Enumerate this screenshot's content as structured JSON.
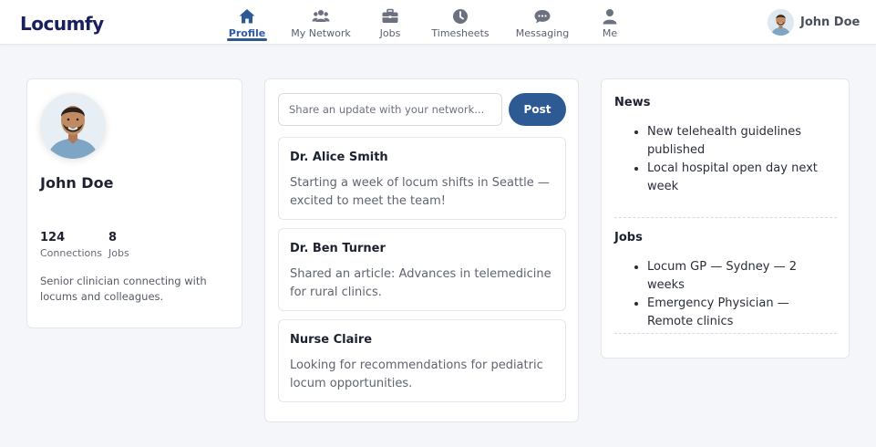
{
  "app": {
    "name": "Locumfy"
  },
  "nav": {
    "items": [
      {
        "label": "Profile",
        "icon": "home-icon",
        "active": true
      },
      {
        "label": "My Network",
        "icon": "users-icon",
        "active": false
      },
      {
        "label": "Jobs",
        "icon": "briefcase-icon",
        "active": false
      },
      {
        "label": "Timesheets",
        "icon": "clock-icon",
        "active": false
      },
      {
        "label": "Messaging",
        "icon": "chat-icon",
        "active": false
      },
      {
        "label": "Me",
        "icon": "user-icon",
        "active": false
      }
    ]
  },
  "user": {
    "name": "John Doe"
  },
  "profile": {
    "name": "John Doe",
    "connections": {
      "value": "124",
      "label": "Connections"
    },
    "jobs": {
      "value": "8",
      "label": "Jobs"
    },
    "bio": "Senior clinician connecting with locums and colleagues."
  },
  "feed": {
    "share_placeholder": "Share an update with your network...",
    "post_label": "Post",
    "posts": [
      {
        "author": "Dr. Alice Smith",
        "text": "Starting a week of locum shifts in Seattle — excited to meet the team!"
      },
      {
        "author": "Dr. Ben Turner",
        "text": "Shared an article: Advances in telemedicine for rural clinics."
      },
      {
        "author": "Nurse Claire",
        "text": "Looking for recommendations for pediatric locum opportunities."
      }
    ]
  },
  "sidebar": {
    "news": {
      "title": "News",
      "items": [
        "New telehealth guidelines published",
        "Local hospital open day next week"
      ]
    },
    "jobs": {
      "title": "Jobs",
      "items": [
        "Locum GP — Sydney — 2 weeks",
        "Emergency Physician — Remote clinics"
      ]
    }
  },
  "colors": {
    "brand": "#1a1f5e",
    "accent": "#2e5a94",
    "background": "#f5f6fa"
  }
}
